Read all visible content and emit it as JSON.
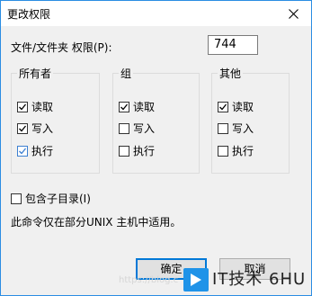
{
  "window": {
    "title": "更改权限"
  },
  "permission": {
    "label": "文件/文件夹 权限(P):",
    "value": "744"
  },
  "groups": [
    {
      "title": "所有者",
      "items": [
        {
          "label": "读取",
          "checked": true
        },
        {
          "label": "写入",
          "checked": true
        },
        {
          "label": "执行",
          "checked": true
        }
      ]
    },
    {
      "title": "组",
      "items": [
        {
          "label": "读取",
          "checked": true
        },
        {
          "label": "写入",
          "checked": false
        },
        {
          "label": "执行",
          "checked": false
        }
      ]
    },
    {
      "title": "其他",
      "items": [
        {
          "label": "读取",
          "checked": true
        },
        {
          "label": "写入",
          "checked": false
        },
        {
          "label": "执行",
          "checked": false
        }
      ]
    }
  ],
  "subdirs": {
    "label": "包含子目录(I)",
    "checked": false
  },
  "note": "此命令仅在部分UNIX 主机中适用。",
  "buttons": {
    "ok": "确定",
    "cancel": "取消"
  },
  "watermark": {
    "brand": "IT技术 6HU",
    "url": "https://blog.c"
  },
  "colors": {
    "accent": "#0078d7",
    "checkmark": "#000000",
    "checkmark_focus": "#3c7fd1"
  }
}
